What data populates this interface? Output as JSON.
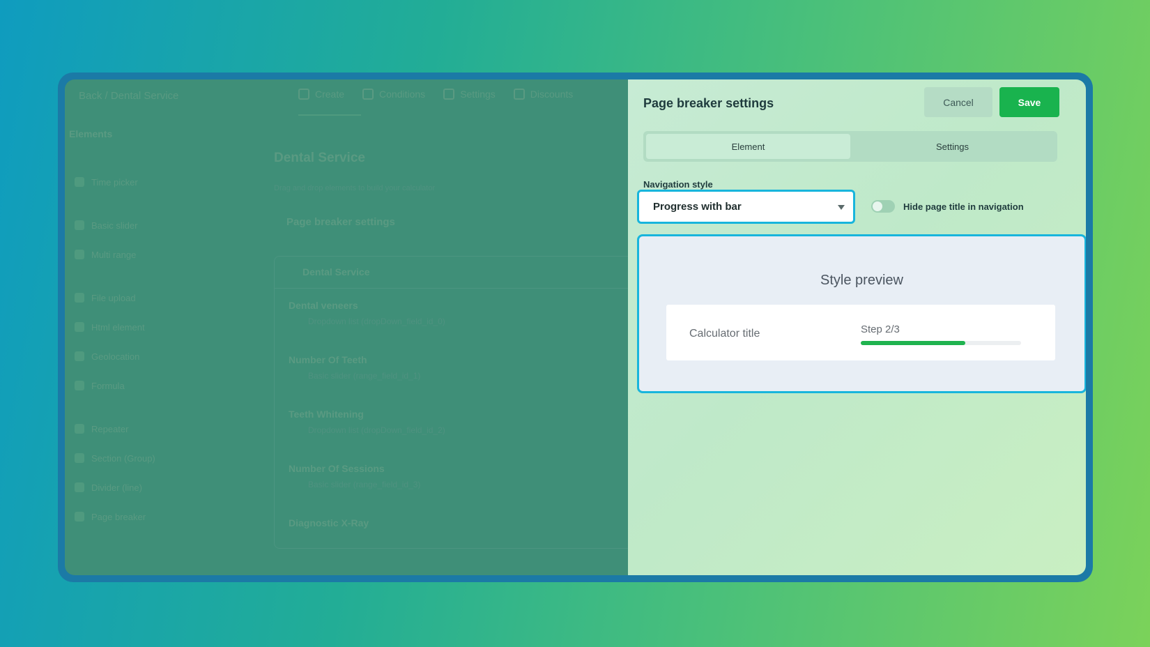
{
  "builder": {
    "breadcrumb": "Back / Dental Service",
    "top_tabs": [
      "Create",
      "Conditions",
      "Settings",
      "Discounts"
    ],
    "sidebar_title": "Elements",
    "sidebar_items": [
      "Time picker",
      "Basic slider",
      "Multi range",
      "File upload",
      "Html element",
      "Geolocation",
      "Formula",
      "Repeater",
      "Section (Group)",
      "Divider (line)",
      "Page breaker"
    ],
    "calculator_name": "Dental Service",
    "calculator_note": "Drag and drop elements to build your calculator",
    "section_title": "Page breaker settings",
    "list_header": "Dental Service",
    "list_rows": [
      {
        "title": "Dental veneers",
        "subtitle": "Dropdown list (dropDown_field_id_0)"
      },
      {
        "title": "Number Of Teeth",
        "subtitle": "Basic slider (range_field_id_1)"
      },
      {
        "title": "Teeth Whitening",
        "subtitle": "Dropdown list (dropDown_field_id_2)"
      },
      {
        "title": "Number Of Sessions",
        "subtitle": "Basic slider (range_field_id_3)"
      },
      {
        "title": "Diagnostic X-Ray",
        "subtitle": ""
      }
    ]
  },
  "panel": {
    "title": "Page breaker settings",
    "cancel_label": "Cancel",
    "save_label": "Save",
    "tabs": {
      "element": "Element",
      "settings": "Settings",
      "active": "Element"
    },
    "navigation_style_label": "Navigation style",
    "navigation_style_value": "Progress with bar",
    "hide_title_label": "Hide page title in navigation",
    "hide_title_enabled": false,
    "preview": {
      "title": "Style preview",
      "calculator_title": "Calculator title",
      "step_text": "Step 2/3",
      "progress_fraction": 0.65
    }
  },
  "colors": {
    "accent": "#18b5dc",
    "save_button": "#19b34e",
    "progress_fill": "#1fb34f"
  }
}
